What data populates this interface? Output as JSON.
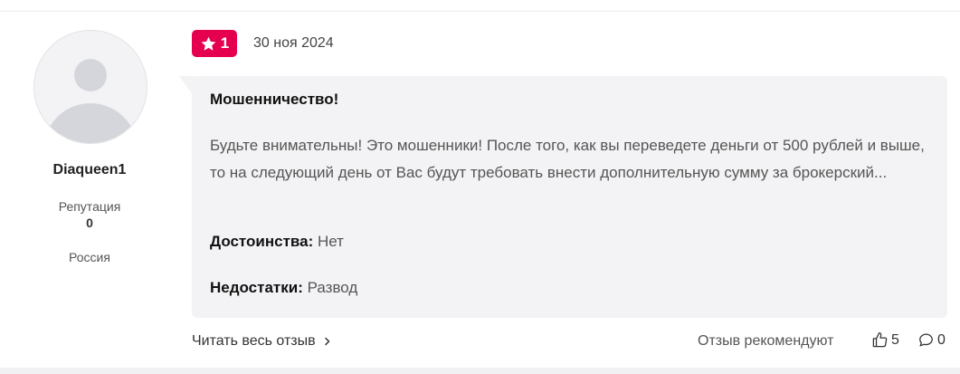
{
  "user": {
    "name": "Diaqueen1",
    "reputation_label": "Репутация",
    "reputation_value": "0",
    "country": "Россия"
  },
  "review": {
    "rating": "1",
    "date": "30 ноя 2024",
    "title": "Мошенничество!",
    "text": "Будьте внимательны! Это мошенники! После того, как вы переведете деньги от 500 рублей и выше, то на следующий день от Вас будут требовать внести дополнительную сумму за брокерский...",
    "pros_label": "Достоинства:",
    "pros_value": "Нет",
    "cons_label": "Недостатки:",
    "cons_value": "Развод"
  },
  "footer": {
    "read_more": "Читать весь отзыв",
    "recommend_label": "Отзыв рекомендуют",
    "likes": "5",
    "comments": "0"
  },
  "colors": {
    "accent": "#e5004f",
    "bubble": "#f3f3f5"
  },
  "icons": {
    "avatar": "user-placeholder-avatar",
    "rating": "star-icon",
    "read_more": "chevron-right-icon",
    "likes": "thumbs-up-icon",
    "comments": "comment-icon"
  }
}
